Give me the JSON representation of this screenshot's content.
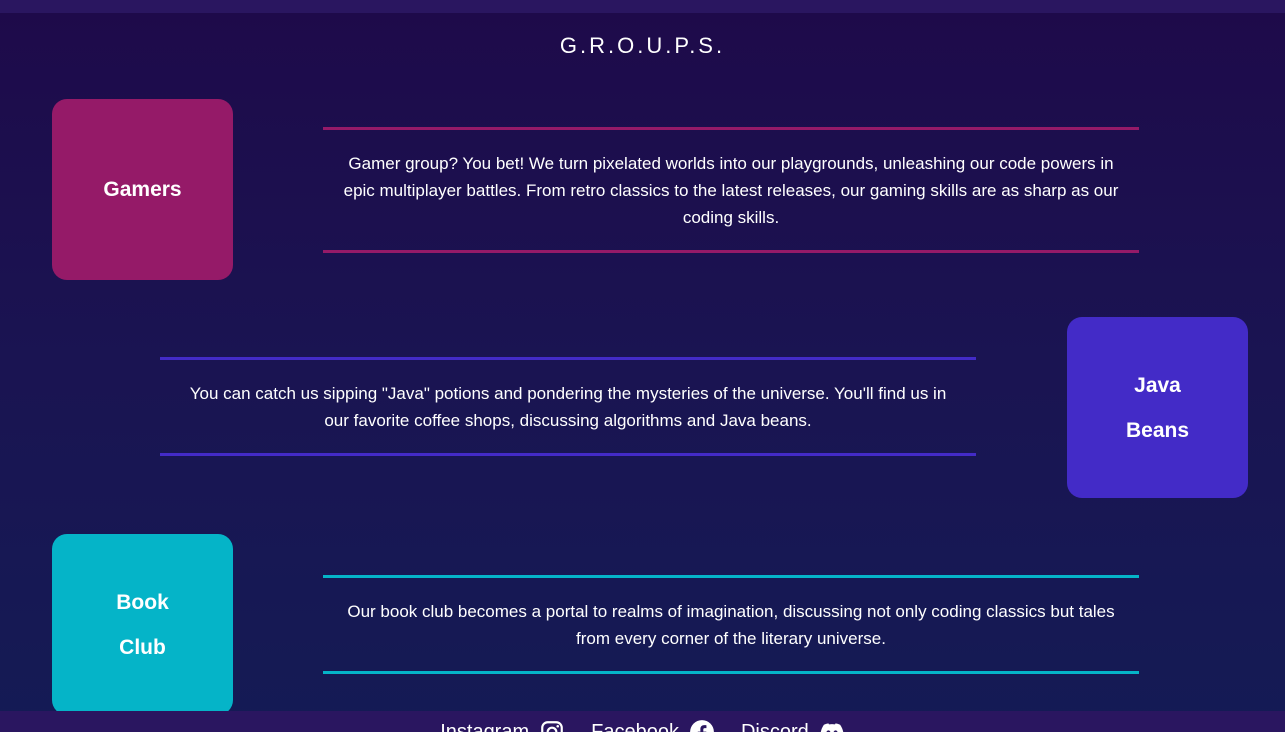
{
  "header": {
    "title": "G.R.O.U.P.S."
  },
  "groups": [
    {
      "name_line1": "Gamers",
      "name_line2": "",
      "color": "#951a68",
      "description": "Gamer group? You bet! We turn pixelated worlds into our playgrounds, unleashing our code powers in epic multiplayer battles. From retro classics to the latest releases, our gaming skills are as sharp as our coding skills."
    },
    {
      "name_line1": "Java",
      "name_line2": "Beans",
      "color": "#432bc7",
      "description": "You can catch us sipping \"Java\" potions and pondering the mysteries of the universe. You'll find us in our favorite coffee shops, discussing algorithms and Java beans."
    },
    {
      "name_line1": "Book",
      "name_line2": "Club",
      "color": "#05b4c8",
      "description": "Our book club becomes a portal to realms of imagination, discussing not only coding classics but tales from every corner of the literary universe."
    }
  ],
  "footer": {
    "links": [
      {
        "label": "Instagram",
        "icon": "instagram-icon"
      },
      {
        "label": "Facebook",
        "icon": "facebook-icon"
      },
      {
        "label": "Discord",
        "icon": "discord-icon"
      }
    ]
  }
}
